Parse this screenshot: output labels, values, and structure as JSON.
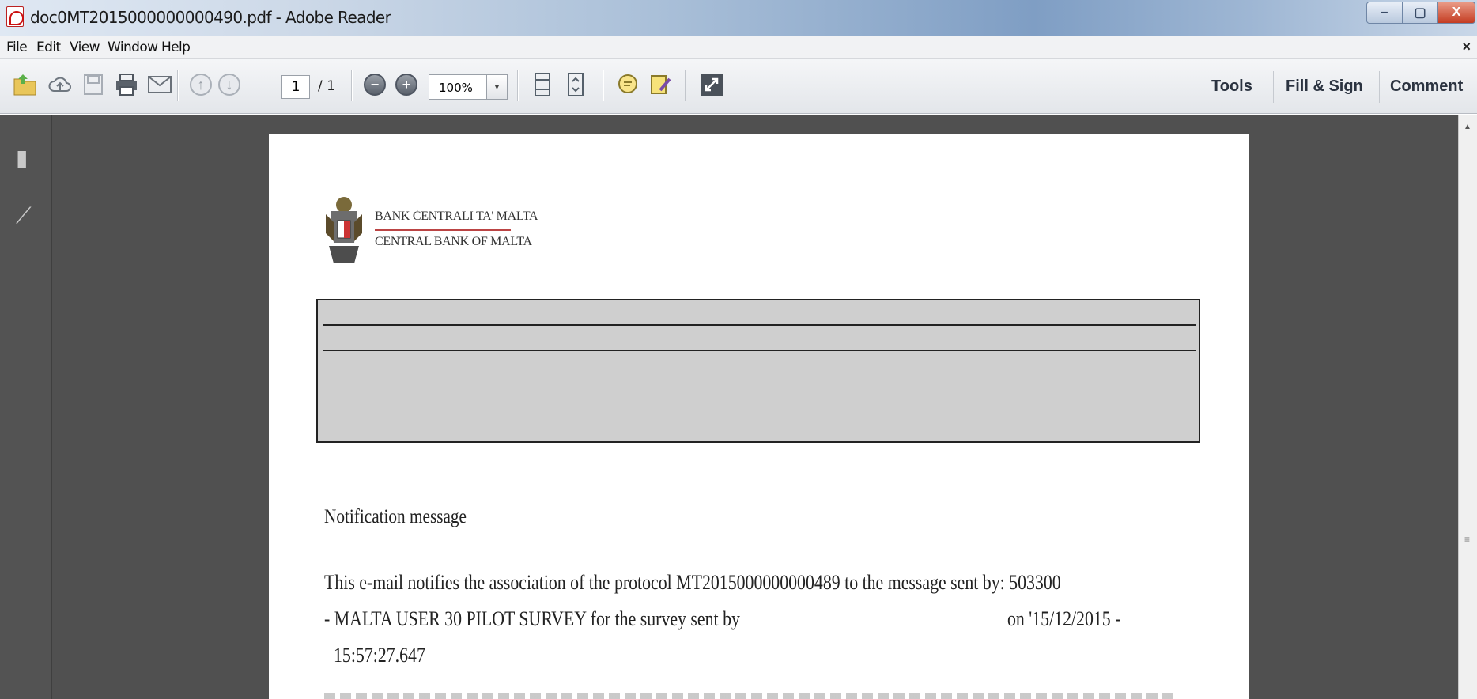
{
  "window": {
    "title": "doc0MT2015000000000490.pdf - Adobe Reader",
    "controls": {
      "minimize": "–",
      "maximize": "▢",
      "close": "X"
    }
  },
  "menu": {
    "items": [
      "File",
      "Edit",
      "View",
      "Window",
      "Help"
    ],
    "close": "×"
  },
  "toolbar": {
    "page_current": "1",
    "page_total": "/ 1",
    "zoom": "100%",
    "tabs": [
      "Tools",
      "Fill & Sign",
      "Comment"
    ]
  },
  "document": {
    "bank_name_mt": "BANK ĊENTRALI TA' MALTA",
    "bank_name_en": "CENTRAL BANK OF MALTA",
    "heading": "Notification message",
    "line1": "This e-mail notifies the association of the protocol MT2015000000000489 to the message sent by: 503300",
    "line2a": "- MALTA USER 30 PILOT SURVEY for the survey  sent by",
    "line2b": "on '15/12/2015 -",
    "line3": "15:57:27.647"
  },
  "colors": {
    "workspace": "#505050",
    "grey_box": "#cfcfcf",
    "accent_red": "#b44"
  }
}
